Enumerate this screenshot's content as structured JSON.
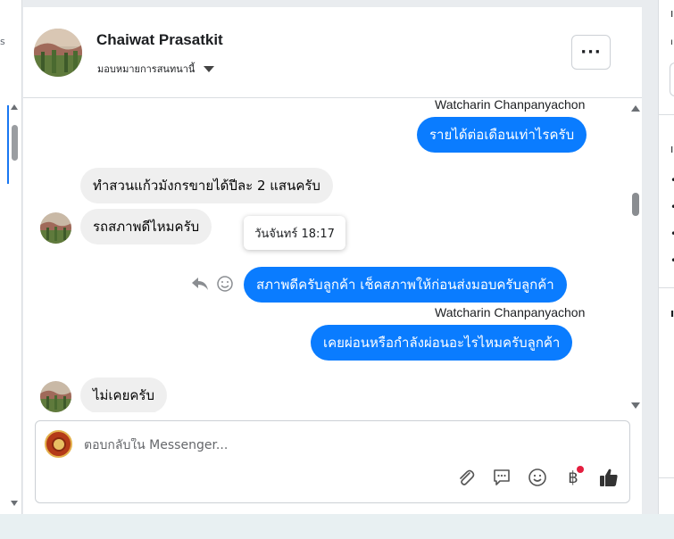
{
  "header": {
    "contact_name": "Chaiwat Prasatkit",
    "assign_label": "มอบหมายการสนทนานี้",
    "more_label": "···"
  },
  "messages": {
    "sender_1": "Watcharin Chanpanyachon",
    "out_1": "รายได้ต่อเดือนเท่าไรครับ",
    "in_1": "ทำสวนแก้วมังกรขายได้ปีละ 2 แสนครับ",
    "in_2": "รถสภาพดีไหมครับ",
    "tooltip": "วันจันทร์ 18:17",
    "out_2": "สภาพดีครับลูกค้า เช็คสภาพให้ก่อนส่งมอบครับลูกค้า",
    "sender_2": "Watcharin Chanpanyachon",
    "out_3": "เคยผ่อนหรือกำลังผ่อนอะไรไหมครับลูกค้า",
    "in_3": "ไม่เคยครับ"
  },
  "composer": {
    "placeholder": "ตอบกลับใน Messenger...",
    "baht_symbol": "฿"
  },
  "icons": [
    "attach-icon",
    "saved-reply-icon",
    "emoji-icon",
    "baht-payment-icon",
    "thumbs-up-icon",
    "reply-icon",
    "react-icon",
    "more-dots-icon"
  ],
  "colors": {
    "outgoing": "#0a7cff",
    "incoming": "#efefef",
    "notification_dot": "#e41e3f"
  }
}
